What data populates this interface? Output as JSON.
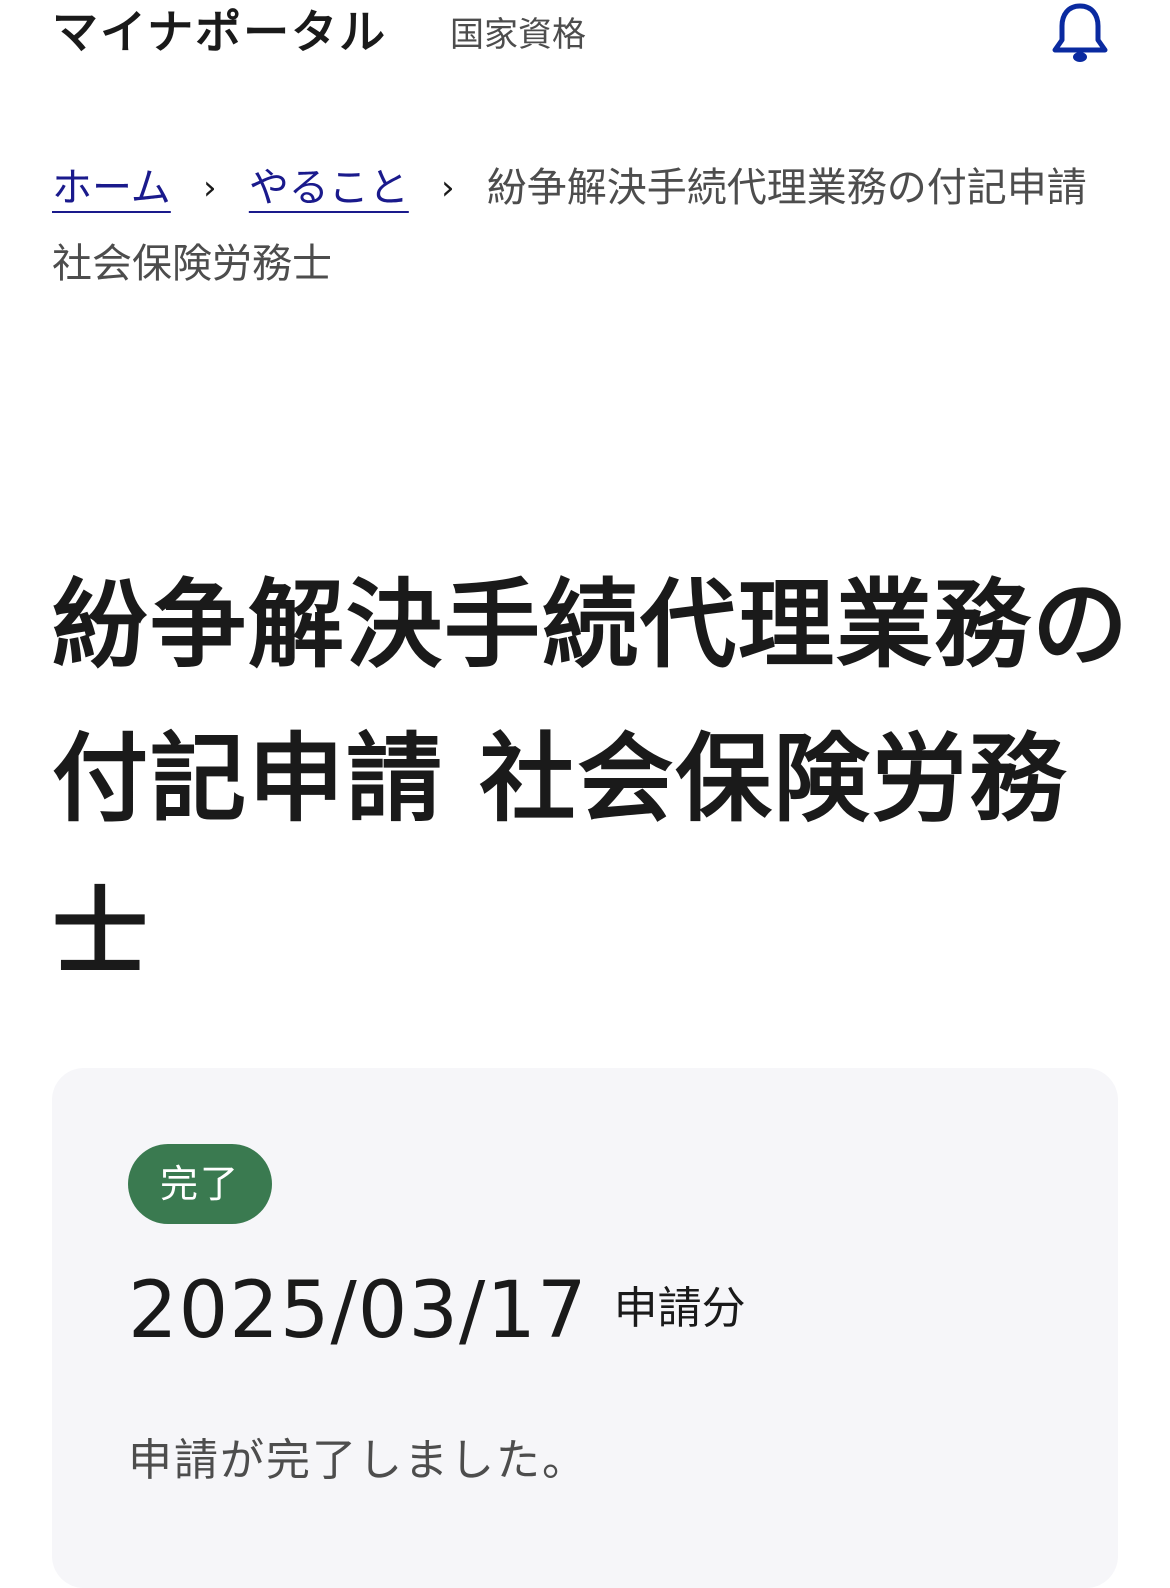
{
  "header": {
    "app_title": "マイナポータル",
    "section": "国家資格",
    "notification_icon": "bell-icon"
  },
  "breadcrumb": {
    "items": [
      {
        "label": "ホーム"
      },
      {
        "label": "やること"
      }
    ],
    "separator": "›",
    "current": "紛争解決手続代理業務の付記申請 社会保険労務士"
  },
  "page": {
    "title": "紛争解決手続代理業務の付記申請 社会保険労務士"
  },
  "status_card": {
    "badge": "完了",
    "date": "2025/03/17",
    "date_suffix": "申請分",
    "message": "申請が完了しました。"
  },
  "colors": {
    "link": "#1a1a8c",
    "accent": "#0a2aa0",
    "badge_bg": "#3a7a50",
    "card_bg": "#f6f6f9"
  }
}
